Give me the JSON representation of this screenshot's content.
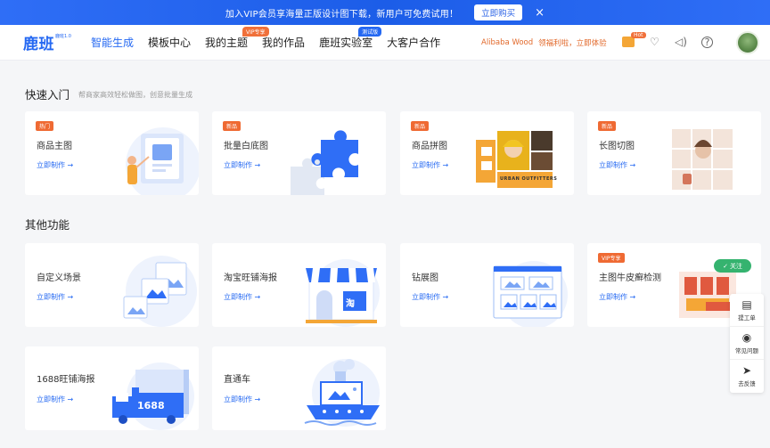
{
  "banner": {
    "text": "加入VIP会员享海量正版设计图下载，新用户可免费试用！",
    "button": "立即购买",
    "close": "×"
  },
  "nav": {
    "logo": "鹿班",
    "logo_sup": "鹿班1.0",
    "items": [
      {
        "label": "智能生成",
        "active": true
      },
      {
        "label": "模板中心"
      },
      {
        "label": "我的主题",
        "tag": "VIP专享"
      },
      {
        "label": "我的作品"
      },
      {
        "label": "鹿班实验室",
        "tag": "测试版"
      },
      {
        "label": "大客户合作"
      }
    ],
    "alibaba": "Alibaba Wood",
    "promo": "领福利啦，立即体验",
    "hot": "Hot",
    "icons": [
      "gift-icon",
      "heart-icon",
      "volume-icon",
      "help-icon"
    ]
  },
  "quick": {
    "title": "快速入门",
    "subtitle": "帮商家高效轻松做图，创意批量生成",
    "cards": [
      {
        "badge": "热门",
        "title": "商品主图",
        "link": "立即制作 →"
      },
      {
        "badge": "新品",
        "title": "批量白底图",
        "link": "立即制作 →"
      },
      {
        "badge": "新品",
        "title": "商品拼图",
        "link": "立即制作 →"
      },
      {
        "badge": "新品",
        "title": "长图切图",
        "link": "立即制作 →"
      }
    ]
  },
  "other": {
    "title": "其他功能",
    "cards": [
      {
        "title": "自定义场景",
        "link": "立即制作 →"
      },
      {
        "title": "淘宝旺铺海报",
        "link": "立即制作 →"
      },
      {
        "title": "钻展图",
        "link": "立即制作 →"
      },
      {
        "badge": "VIP专享",
        "title": "主图牛皮癣检测",
        "link": "立即制作 →"
      },
      {
        "title": "1688旺铺海报",
        "link": "立即制作 →"
      },
      {
        "title": "直通车",
        "link": "立即制作 →"
      }
    ]
  },
  "art_text": {
    "urban": "URBAN OUTFITTERS",
    "taobao": "淘",
    "truck": "1688"
  },
  "follow": "关注",
  "side": [
    {
      "icon": "clipboard-icon",
      "label": "提工单"
    },
    {
      "icon": "question-icon",
      "label": "常见问题"
    },
    {
      "icon": "plane-icon",
      "label": "去反馈"
    }
  ],
  "colors": {
    "accent": "#2468f2",
    "orange": "#ef6a33",
    "green": "#35b36f"
  }
}
